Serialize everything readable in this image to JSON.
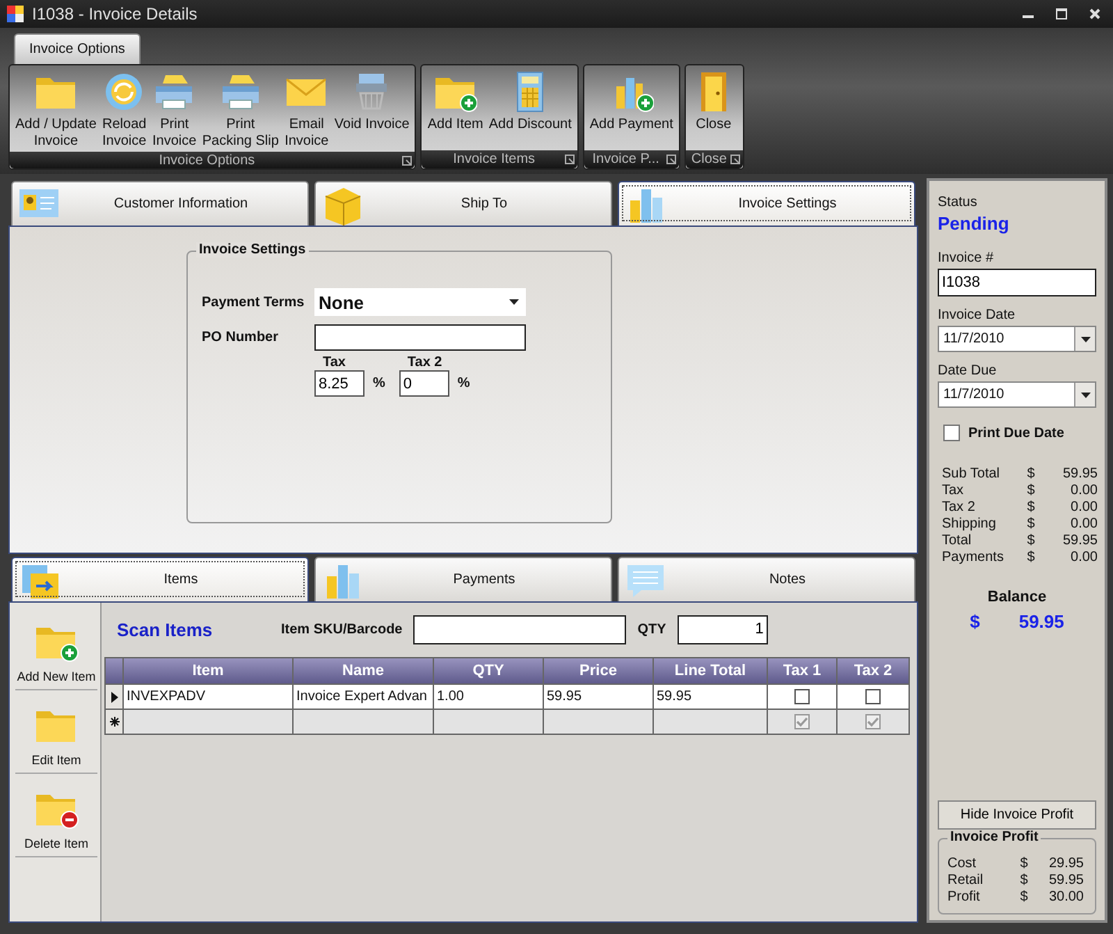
{
  "window": {
    "title": "I1038 - Invoice Details"
  },
  "ribbon": {
    "tabs": [
      {
        "label": "Invoice Options",
        "selected": true
      }
    ],
    "groups": [
      {
        "label": "Invoice Options",
        "buttons": [
          "Add / Update\nInvoice",
          "Reload\nInvoice",
          "Print\nInvoice",
          "Print\nPacking Slip",
          "Email\nInvoice",
          "Void Invoice"
        ]
      },
      {
        "label": "Invoice Items",
        "buttons": [
          "Add Item",
          "Add Discount"
        ]
      },
      {
        "label": "Invoice P...",
        "buttons": [
          "Add Payment"
        ]
      },
      {
        "label": "Close",
        "buttons": [
          "Close"
        ]
      }
    ]
  },
  "top_tabs": [
    {
      "label": "Customer Information",
      "selected": false
    },
    {
      "label": "Ship To",
      "selected": false
    },
    {
      "label": "Invoice Settings",
      "selected": true
    }
  ],
  "invoice_settings": {
    "title": "Invoice Settings",
    "payment_terms": {
      "label": "Payment Terms",
      "value": "None"
    },
    "po_number": {
      "label": "PO Number"
    },
    "tax": {
      "label": "Tax",
      "value": "8.25",
      "unit": "%"
    },
    "tax_2": {
      "label": "Tax 2",
      "value": "0",
      "unit": "%"
    }
  },
  "bottom_tabs": [
    {
      "label": "Items",
      "selected": true
    },
    {
      "label": "Payments",
      "selected": false
    },
    {
      "label": "Notes",
      "selected": false
    }
  ],
  "item_actions": [
    "Add New Item",
    "Edit Item",
    "Delete Item"
  ],
  "scan": {
    "title": "Scan Items",
    "sku_label": "Item SKU/Barcode",
    "qty_label": "QTY",
    "qty_value": "1"
  },
  "items_grid": {
    "columns": [
      "Item",
      "Name",
      "QTY",
      "Price",
      "Line Total",
      "Tax 1",
      "Tax 2"
    ],
    "rows": [
      {
        "kind": "current",
        "item": "INVEXPADV",
        "name": "Invoice Expert Advan",
        "qty": "1.00",
        "price": "59.95",
        "line_total": "59.95",
        "tax_1": false,
        "tax_2": false
      },
      {
        "kind": "new",
        "tax_1": true,
        "tax_2": true
      }
    ]
  },
  "summary": {
    "status_label": "Status",
    "status": "Pending",
    "invoice_no": {
      "label": "Invoice #",
      "value": "I1038"
    },
    "invoice_date": {
      "label": "Invoice Date",
      "value": "11/7/2010"
    },
    "date_due": {
      "label": "Date Due",
      "value": "11/7/2010"
    },
    "print_due_date": {
      "label": "Print Due Date",
      "checked": false
    },
    "totals": [
      {
        "label": "Sub Total",
        "currency": "$",
        "amount": "59.95"
      },
      {
        "label": "Tax",
        "currency": "$",
        "amount": "0.00"
      },
      {
        "label": "Tax 2",
        "currency": "$",
        "amount": "0.00"
      },
      {
        "label": "Shipping",
        "currency": "$",
        "amount": "0.00"
      },
      {
        "label": "Total",
        "currency": "$",
        "amount": "59.95"
      },
      {
        "label": "Payments",
        "currency": "$",
        "amount": "0.00"
      }
    ],
    "balance": {
      "label": "Balance",
      "currency": "$",
      "amount": "59.95"
    },
    "profit_button": "Hide Invoice Profit",
    "profit": {
      "title": "Invoice Profit",
      "rows": [
        {
          "label": "Cost",
          "currency": "$",
          "amount": "29.95"
        },
        {
          "label": "Retail",
          "currency": "$",
          "amount": "59.95"
        },
        {
          "label": "Profit",
          "currency": "$",
          "amount": "30.00"
        }
      ]
    }
  }
}
